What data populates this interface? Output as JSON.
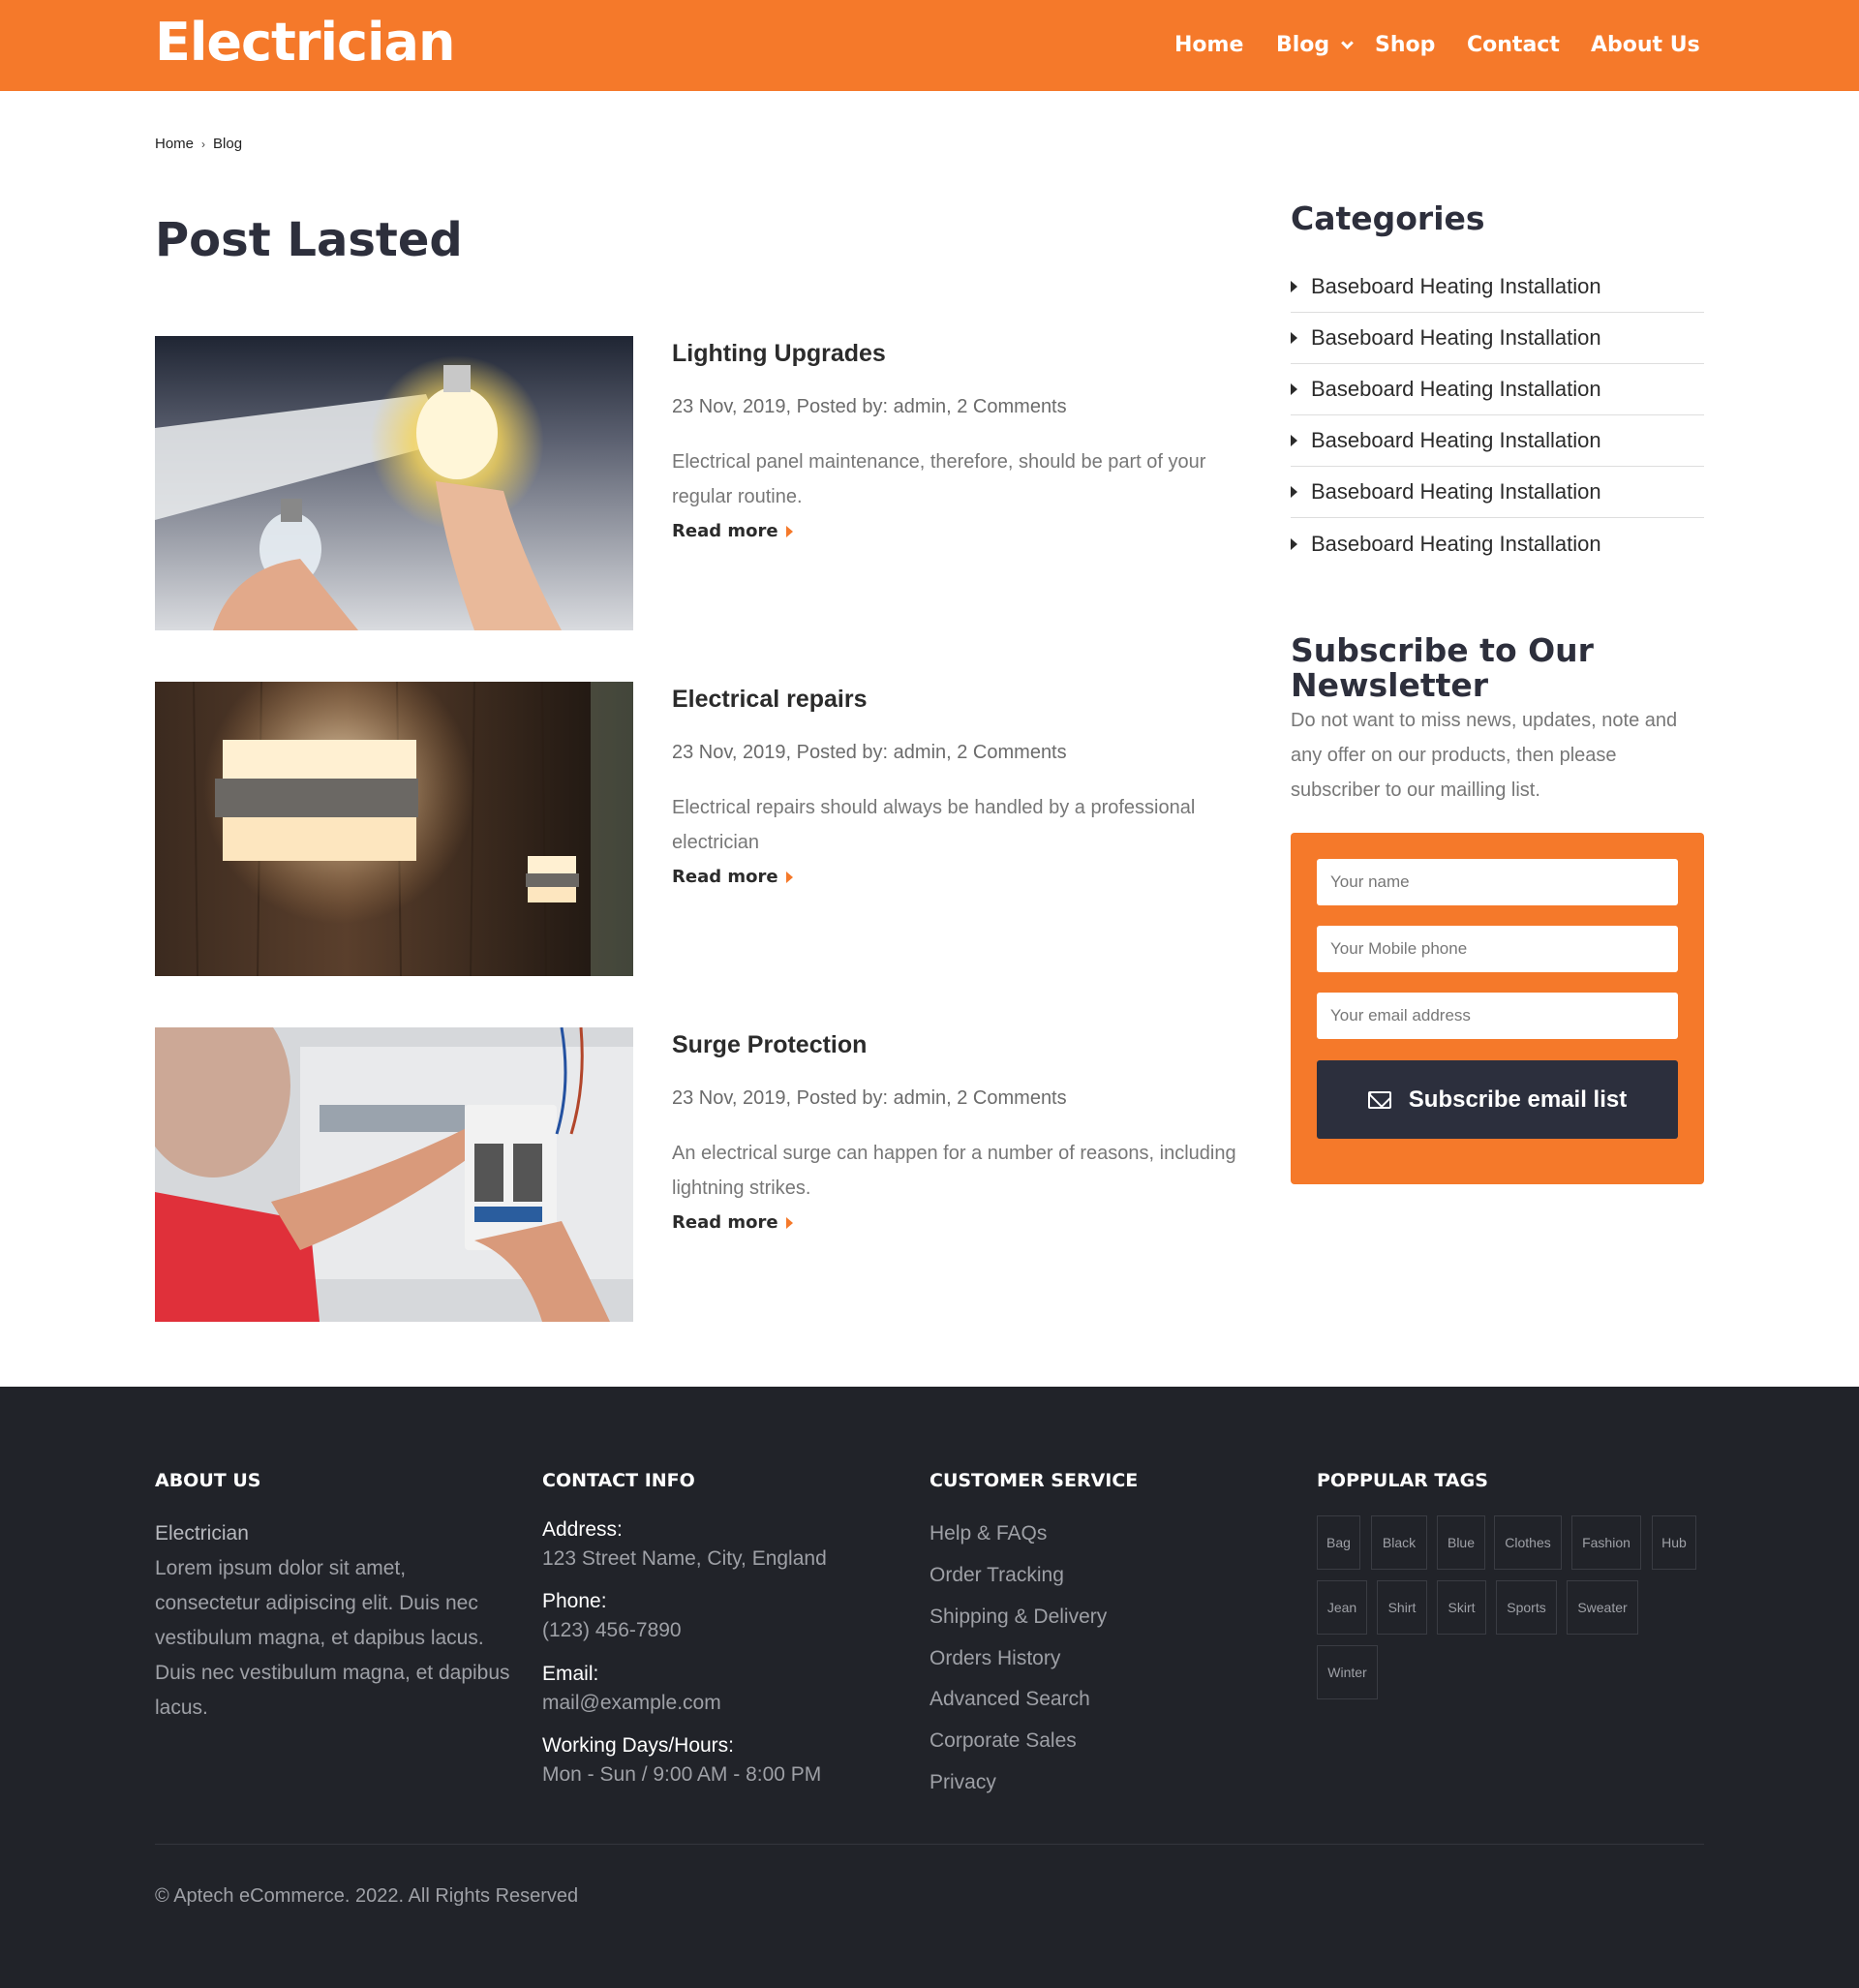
{
  "header": {
    "logo": "Electrician",
    "nav": [
      {
        "label": "Home"
      },
      {
        "label": "Blog"
      },
      {
        "label": "Shop"
      },
      {
        "label": "Contact"
      },
      {
        "label": "About Us"
      }
    ]
  },
  "breadcrumb": {
    "items": [
      "Home",
      "Blog"
    ],
    "separator": "›"
  },
  "main": {
    "title": "Post Lasted",
    "posts": [
      {
        "title": "Lighting Upgrades",
        "meta": "23 Nov, 2019, Posted by: admin, 2 Comments",
        "excerpt": "Electrical panel maintenance, therefore, should be part of your regular routine.",
        "read_more": "Read more",
        "image": "lightbulb-photo"
      },
      {
        "title": "Electrical repairs",
        "meta": "23 Nov, 2019, Posted by: admin, 2 Comments",
        "excerpt": "Electrical repairs should always be handled by a professional electrician",
        "read_more": "Read more",
        "image": "wall-lamp-photo"
      },
      {
        "title": "Surge Protection",
        "meta": "23 Nov, 2019, Posted by: admin, 2 Comments",
        "excerpt": "An electrical surge can happen for a number of reasons, including lightning strikes.",
        "read_more": "Read more",
        "image": "electrician-breaker-photo"
      }
    ]
  },
  "sidebar": {
    "categories_title": "Categories",
    "categories": [
      "Baseboard Heating Installation",
      "Baseboard Heating Installation",
      "Baseboard Heating Installation",
      "Baseboard Heating Installation",
      "Baseboard Heating Installation",
      "Baseboard Heating Installation"
    ],
    "newsletter": {
      "title_line1": "Subscribe to Our",
      "title_line2": "Newsletter",
      "text": "Do not want to miss news, updates, note and any offer on our products, then please subscriber to our mailling list.",
      "name_placeholder": "Your name",
      "phone_placeholder": "Your Mobile phone",
      "email_placeholder": "Your email address",
      "button_label": "Subscribe email list",
      "button_icon": "envelope-icon"
    }
  },
  "footer": {
    "about": {
      "heading": "ABOUT US",
      "name": "Electrician",
      "text": "Lorem ipsum dolor sit amet, consectetur adipiscing elit. Duis nec vestibulum magna, et dapibus lacus. Duis nec vestibulum magna, et dapibus lacus."
    },
    "contact": {
      "heading": "CONTACT INFO",
      "address_label": "Address:",
      "address": "123 Street Name, City, England",
      "phone_label": "Phone:",
      "phone": "(123) 456-7890",
      "email_label": "Email:",
      "email": "mail@example.com",
      "hours_label": "Working Days/Hours:",
      "hours": "Mon - Sun / 9:00 AM - 8:00 PM"
    },
    "service": {
      "heading": "CUSTOMER SERVICE",
      "links": [
        "Help & FAQs",
        "Order Tracking",
        "Shipping & Delivery",
        "Orders History",
        "Advanced Search",
        "Corporate Sales",
        "Privacy"
      ]
    },
    "tags": {
      "heading": "POPPULAR TAGS",
      "items": [
        "Bag",
        "Black",
        "Blue",
        "Clothes",
        "Fashion",
        "Hub",
        "Jean",
        "Shirt",
        "Skirt",
        "Sports",
        "Sweater",
        "Winter"
      ]
    },
    "copyright": "© Aptech eCommerce. 2022. All Rights Reserved"
  },
  "colors": {
    "accent": "#f5792a",
    "dark": "#2c2f3d",
    "footer_bg": "#212329"
  }
}
